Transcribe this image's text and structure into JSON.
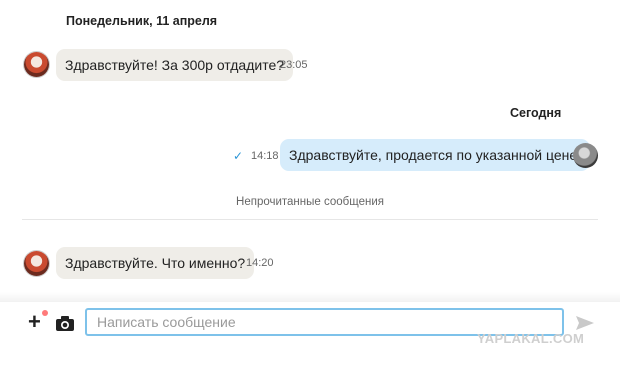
{
  "date_separators": [
    "Понедельник, 11 апреля",
    "Сегодня"
  ],
  "messages": [
    {
      "text": "Здравствуйте! За 300р отдадите?",
      "time": "23:05",
      "direction": "incoming"
    },
    {
      "text": "Здравствуйте, продается по указанной цене.",
      "time": "14:18",
      "direction": "outgoing",
      "read": true
    },
    {
      "text": "Здравствуйте. Что именно?",
      "time": "14:20",
      "direction": "incoming"
    }
  ],
  "unread_divider": "Непрочитанные сообщения",
  "composer": {
    "placeholder": "Написать сообщение",
    "value": "",
    "add_icon": "plus-icon",
    "camera_icon": "camera-icon",
    "send_icon": "send-icon"
  },
  "watermark": "YAPLAKAL.COM",
  "colors": {
    "incoming_bubble": "#efede8",
    "outgoing_bubble": "#d6ecfb",
    "read_check": "#2b95d6",
    "input_border": "#7ec2ea"
  }
}
